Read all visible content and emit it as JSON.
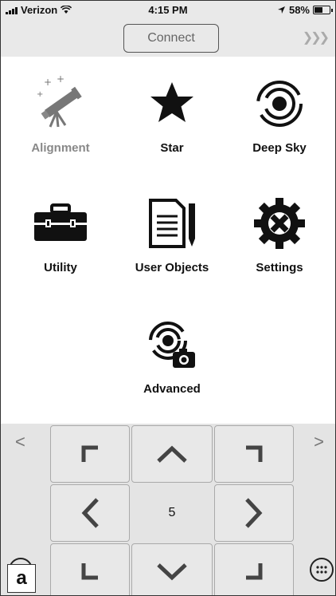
{
  "status_bar": {
    "carrier": "Verizon",
    "time": "4:15 PM",
    "battery": "58%",
    "battery_level": 0.58
  },
  "toolbar": {
    "connect_label": "Connect",
    "forward_icon": "triple-chevron-right-icon"
  },
  "menu": {
    "items": [
      {
        "label": "Alignment",
        "icon": "telescope-icon"
      },
      {
        "label": "Star",
        "icon": "star-icon"
      },
      {
        "label": "Deep Sky",
        "icon": "galaxy-icon"
      },
      {
        "label": "Utility",
        "icon": "toolbox-icon"
      },
      {
        "label": "User Objects",
        "icon": "document-pencil-icon"
      },
      {
        "label": "Settings",
        "icon": "gear-icon"
      },
      {
        "label": "Advanced",
        "icon": "galaxy-camera-icon"
      }
    ]
  },
  "keypad": {
    "center_value": "5",
    "left_arrow": "<",
    "right_arrow": ">"
  },
  "figure_label": "a"
}
